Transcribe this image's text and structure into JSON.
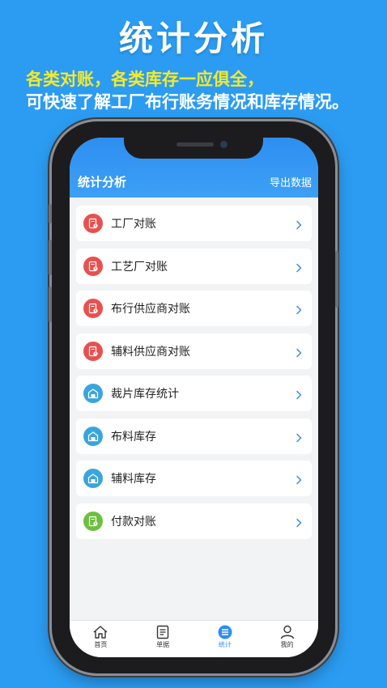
{
  "promo": {
    "title": "统计分析",
    "line1": "各类对账，各类库存一应俱全，",
    "line2": "可快速了解工厂布行账务情况和库存情况。"
  },
  "appbar": {
    "title": "统计分析",
    "action": "导出数据"
  },
  "menu": [
    {
      "label": "工厂对账",
      "icon": "bill-icon",
      "color": "#e8504f"
    },
    {
      "label": "工艺厂对账",
      "icon": "bill-icon",
      "color": "#e8504f"
    },
    {
      "label": "布行供应商对账",
      "icon": "bill-icon",
      "color": "#e8504f"
    },
    {
      "label": "辅料供应商对账",
      "icon": "bill-icon",
      "color": "#e8504f"
    },
    {
      "label": "裁片库存统计",
      "icon": "warehouse-icon",
      "color": "#3aa5dc"
    },
    {
      "label": "布料库存",
      "icon": "warehouse-icon",
      "color": "#3aa5dc"
    },
    {
      "label": "辅料库存",
      "icon": "warehouse-icon",
      "color": "#3aa5dc"
    },
    {
      "label": "付款对账",
      "icon": "payment-icon",
      "color": "#6cbf3f"
    }
  ],
  "tabbar": {
    "tabs": [
      {
        "label": "首页",
        "icon": "home-icon"
      },
      {
        "label": "单据",
        "icon": "document-icon"
      },
      {
        "label": "统计",
        "icon": "stats-icon",
        "active": true
      },
      {
        "label": "我的",
        "icon": "user-icon"
      }
    ]
  },
  "colors": {
    "background": "#2b9cf2",
    "accent": "#2d8ef0",
    "highlight": "#f5e92b"
  }
}
